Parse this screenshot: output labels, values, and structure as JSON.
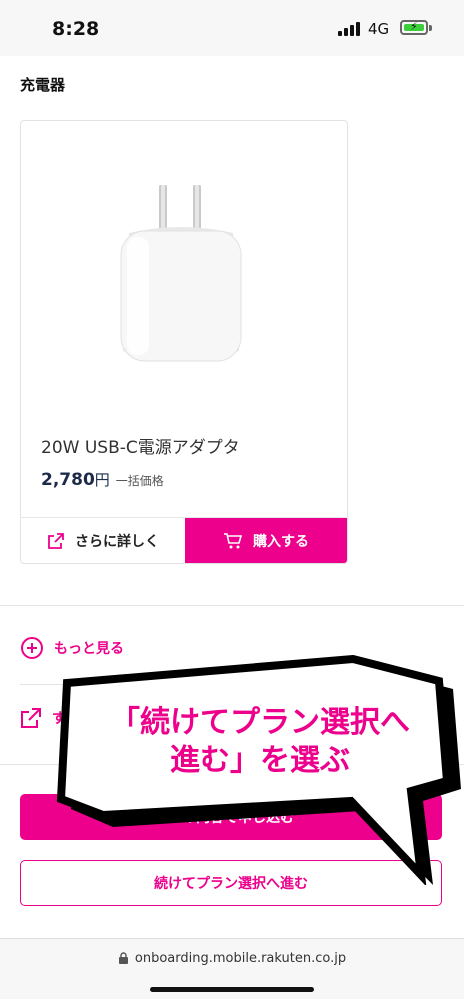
{
  "status_bar": {
    "time": "8:28",
    "network": "4G"
  },
  "section": {
    "title": "充電器"
  },
  "product": {
    "name": "20W USB-C電源アダプタ",
    "price": "2,780",
    "price_unit": "円",
    "price_note": "一括価格",
    "detail_label": "さらに詳しく",
    "buy_label": "購入する"
  },
  "links": {
    "more_label": "もっと見る",
    "ext_label": "す"
  },
  "buttons": {
    "primary_label": "この内容で申し込む",
    "secondary_label": "続けてプラン選択へ進む"
  },
  "url_bar": {
    "domain": "onboarding.mobile.rakuten.co.jp"
  },
  "callout": {
    "line1": "「続けてプラン選択へ",
    "line2": "進む」を選ぶ"
  },
  "colors": {
    "accent": "#ec008c",
    "price": "#1d2b49"
  }
}
